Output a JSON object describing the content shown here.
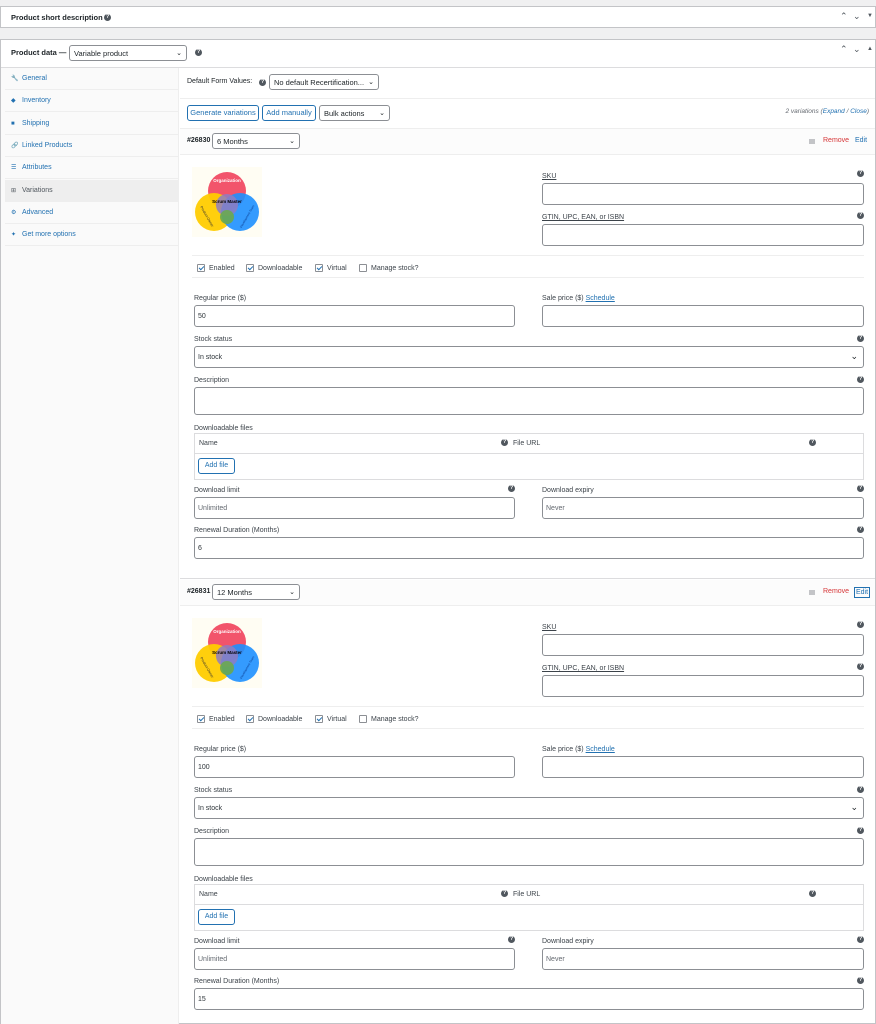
{
  "short_description": {
    "title": "Product short description"
  },
  "product_data": {
    "title": "Product data —",
    "type_value": "Variable product"
  },
  "tabs": [
    {
      "label": "General",
      "icon": "wrench-icon"
    },
    {
      "label": "Inventory",
      "icon": "tag-icon"
    },
    {
      "label": "Shipping",
      "icon": "truck-icon"
    },
    {
      "label": "Linked Products",
      "icon": "link-icon"
    },
    {
      "label": "Attributes",
      "icon": "list-icon"
    },
    {
      "label": "Variations",
      "icon": "grid-icon"
    },
    {
      "label": "Advanced",
      "icon": "gear-icon"
    },
    {
      "label": "Get more options",
      "icon": "plugin-icon"
    }
  ],
  "toolbar": {
    "default_form_label": "Default Form Values:",
    "default_form_value": "No default Recertification...",
    "generate_label": "Generate variations",
    "add_manually_label": "Add manually",
    "bulk_actions_label": "Bulk actions",
    "count_text": "2 variations (",
    "expand_label": "Expand",
    "sep": " / ",
    "close_label": "Close",
    "count_end": ")"
  },
  "venn": {
    "top": "Organization",
    "center": "Scrum Master",
    "left": "Product Owner",
    "right": "Development Team"
  },
  "labels": {
    "remove": "Remove",
    "edit": "Edit",
    "sku": "SKU",
    "gtin": "GTIN, UPC, EAN, or ISBN",
    "enabled": "Enabled",
    "downloadable": "Downloadable",
    "virtual": "Virtual",
    "manage_stock": "Manage stock?",
    "regular_price": "Regular price ($)",
    "sale_price": "Sale price ($)",
    "schedule": "Schedule",
    "stock_status": "Stock status",
    "description": "Description",
    "downloadable_files": "Downloadable files",
    "name_col": "Name",
    "file_url_col": "File URL",
    "add_file": "Add file",
    "download_limit": "Download limit",
    "download_expiry": "Download expiry",
    "renewal_duration": "Renewal Duration (Months)"
  },
  "variations": [
    {
      "id": "#26830",
      "option": "6 Months",
      "regular_price": "50",
      "stock_status": "In stock",
      "download_limit_placeholder": "Unlimited",
      "download_expiry_placeholder": "Never",
      "renewal": "6"
    },
    {
      "id": "#26831",
      "option": "12 Months",
      "regular_price": "100",
      "stock_status": "In stock",
      "download_limit_placeholder": "Unlimited",
      "download_expiry_placeholder": "Never",
      "renewal": "15"
    }
  ],
  "colors": {
    "link": "#2271b1",
    "remove": "#d63638",
    "venn_red": "#f2546b",
    "venn_yellow": "#ffcc00",
    "venn_blue": "#1e90ff",
    "venn_purple": "#8e7cc3",
    "venn_green": "#6aa84f"
  }
}
